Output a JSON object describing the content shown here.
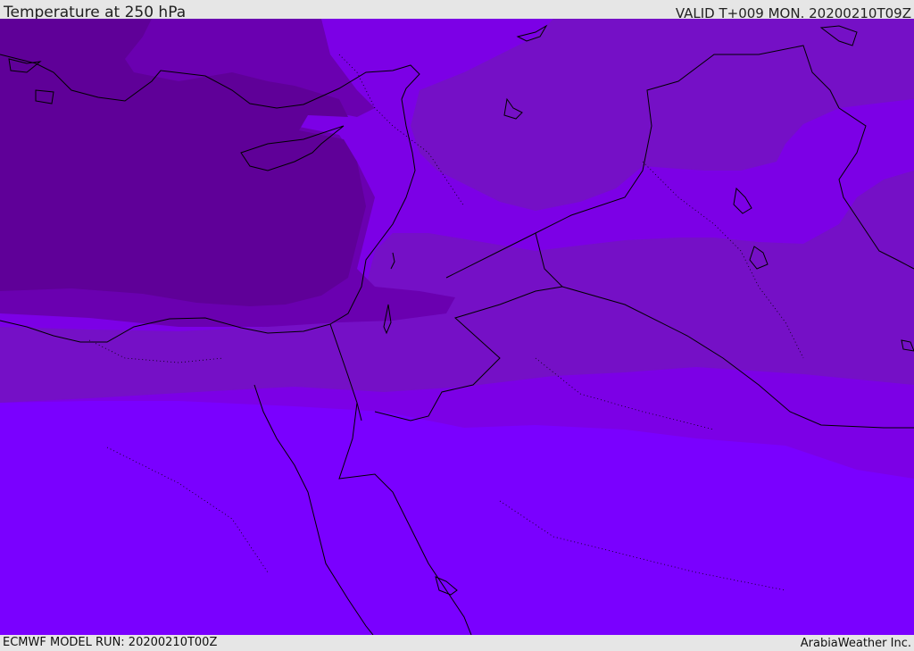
{
  "header": {
    "title": "Temperature at 250 hPa",
    "valid": "VALID T+009 MON. 20200210T09Z"
  },
  "footer": {
    "model_run": "ECMWF MODEL RUN: 20200210T00Z",
    "credit": "ArabiaWeather Inc."
  },
  "colors": {
    "band_darkest": "#5f0098",
    "band_dark": "#6a00b0",
    "band_mid": "#7810c8",
    "band_light": "#7c00e6",
    "band_lightest": "#7a00ff",
    "coastline": "#000000"
  }
}
